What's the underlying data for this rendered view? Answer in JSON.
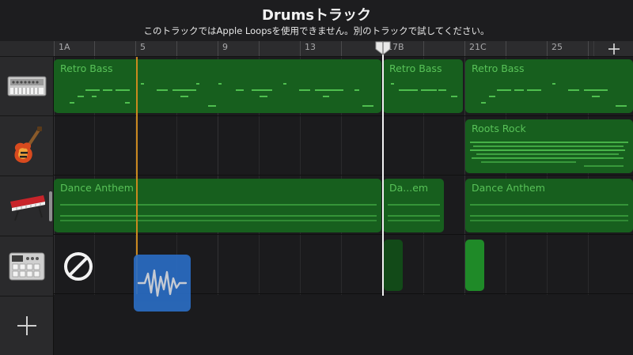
{
  "header": {
    "title": "Drumsトラック",
    "subtitle": "このトラックではApple Loopsを使用できません。別のトラックで試してください。"
  },
  "ruler": {
    "labels": [
      "1A",
      "5",
      "9",
      "13",
      "17B",
      "21C",
      "25"
    ]
  },
  "tracks": [
    {
      "instrument": "synth-bass-keyboard"
    },
    {
      "instrument": "electric-guitar"
    },
    {
      "instrument": "synth-keyboard"
    },
    {
      "instrument": "drum-machine"
    }
  ],
  "regions": {
    "track1": [
      "Retro Bass",
      "Retro Bass",
      "Retro Bass"
    ],
    "track2": [
      "Roots Rock"
    ],
    "track3": [
      "Dance Anthem",
      "Da...em",
      "Dance Anthem"
    ]
  },
  "drag": {
    "icon": "waveform-icon",
    "status_icon": "prohibited-icon"
  },
  "colors": {
    "region_green": "#175f1e",
    "region_label": "#58c258",
    "playhead": "#f2f2f2",
    "drag_line": "#c9891f",
    "drag_tile": "#2a6cc2"
  }
}
